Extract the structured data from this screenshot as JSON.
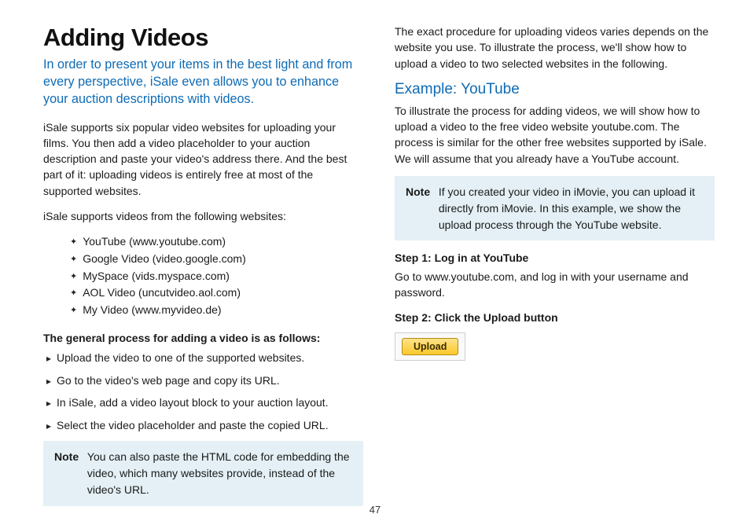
{
  "title": "Adding Videos",
  "intro": "In order to present your items in the best light and from every perspective, iSale even allows you to enhance your auction descriptions with videos.",
  "para1": "iSale supports six popular video websites for uploading your films. You then add a video placeholder to your auction description and paste your video's address there. And the best part of it: uploading videos is entirely free at most of the supported websites.",
  "para2": "iSale supports videos from the following websites:",
  "sites": [
    "YouTube (www.youtube.com)",
    "Google Video (video.google.com)",
    "MySpace (vids.myspace.com)",
    "AOL Video (uncutvideo.aol.com)",
    "My Video (www.myvideo.de)"
  ],
  "process_heading": "The general process for adding a video is as follows:",
  "steps_general": [
    "Upload the video to one of the supported websites.",
    "Go to the video's web page and copy its URL.",
    "In iSale, add a video layout block to your auction layout.",
    "Select the video placeholder and paste the copied URL."
  ],
  "note1_label": "Note",
  "note1_text": "You can also paste the HTML code for embedding the video, which many websites provide, instead of the video's URL.",
  "right_para1": "The exact procedure for uploading videos varies depends on the website you use. To illustrate the process, we'll show how to upload a video to two selected websites in the following.",
  "example_heading": "Example: YouTube",
  "right_para2": "To illustrate the process for adding videos, we will show how to upload a video to the free video website youtube.com. The process is similar for the other free websites supported by iSale. We will assume that you already have a YouTube account.",
  "note2_label": "Note",
  "note2_text": "If you created your video in iMovie, you can upload it directly from iMovie. In this example, we show the upload process through the YouTube website.",
  "step1_title": "Step 1: Log in at YouTube",
  "step1_body": "Go to www.youtube.com, and log in with your username and password.",
  "step2_title": "Step 2: Click the Upload button",
  "upload_label": "Upload",
  "page_number": "47"
}
